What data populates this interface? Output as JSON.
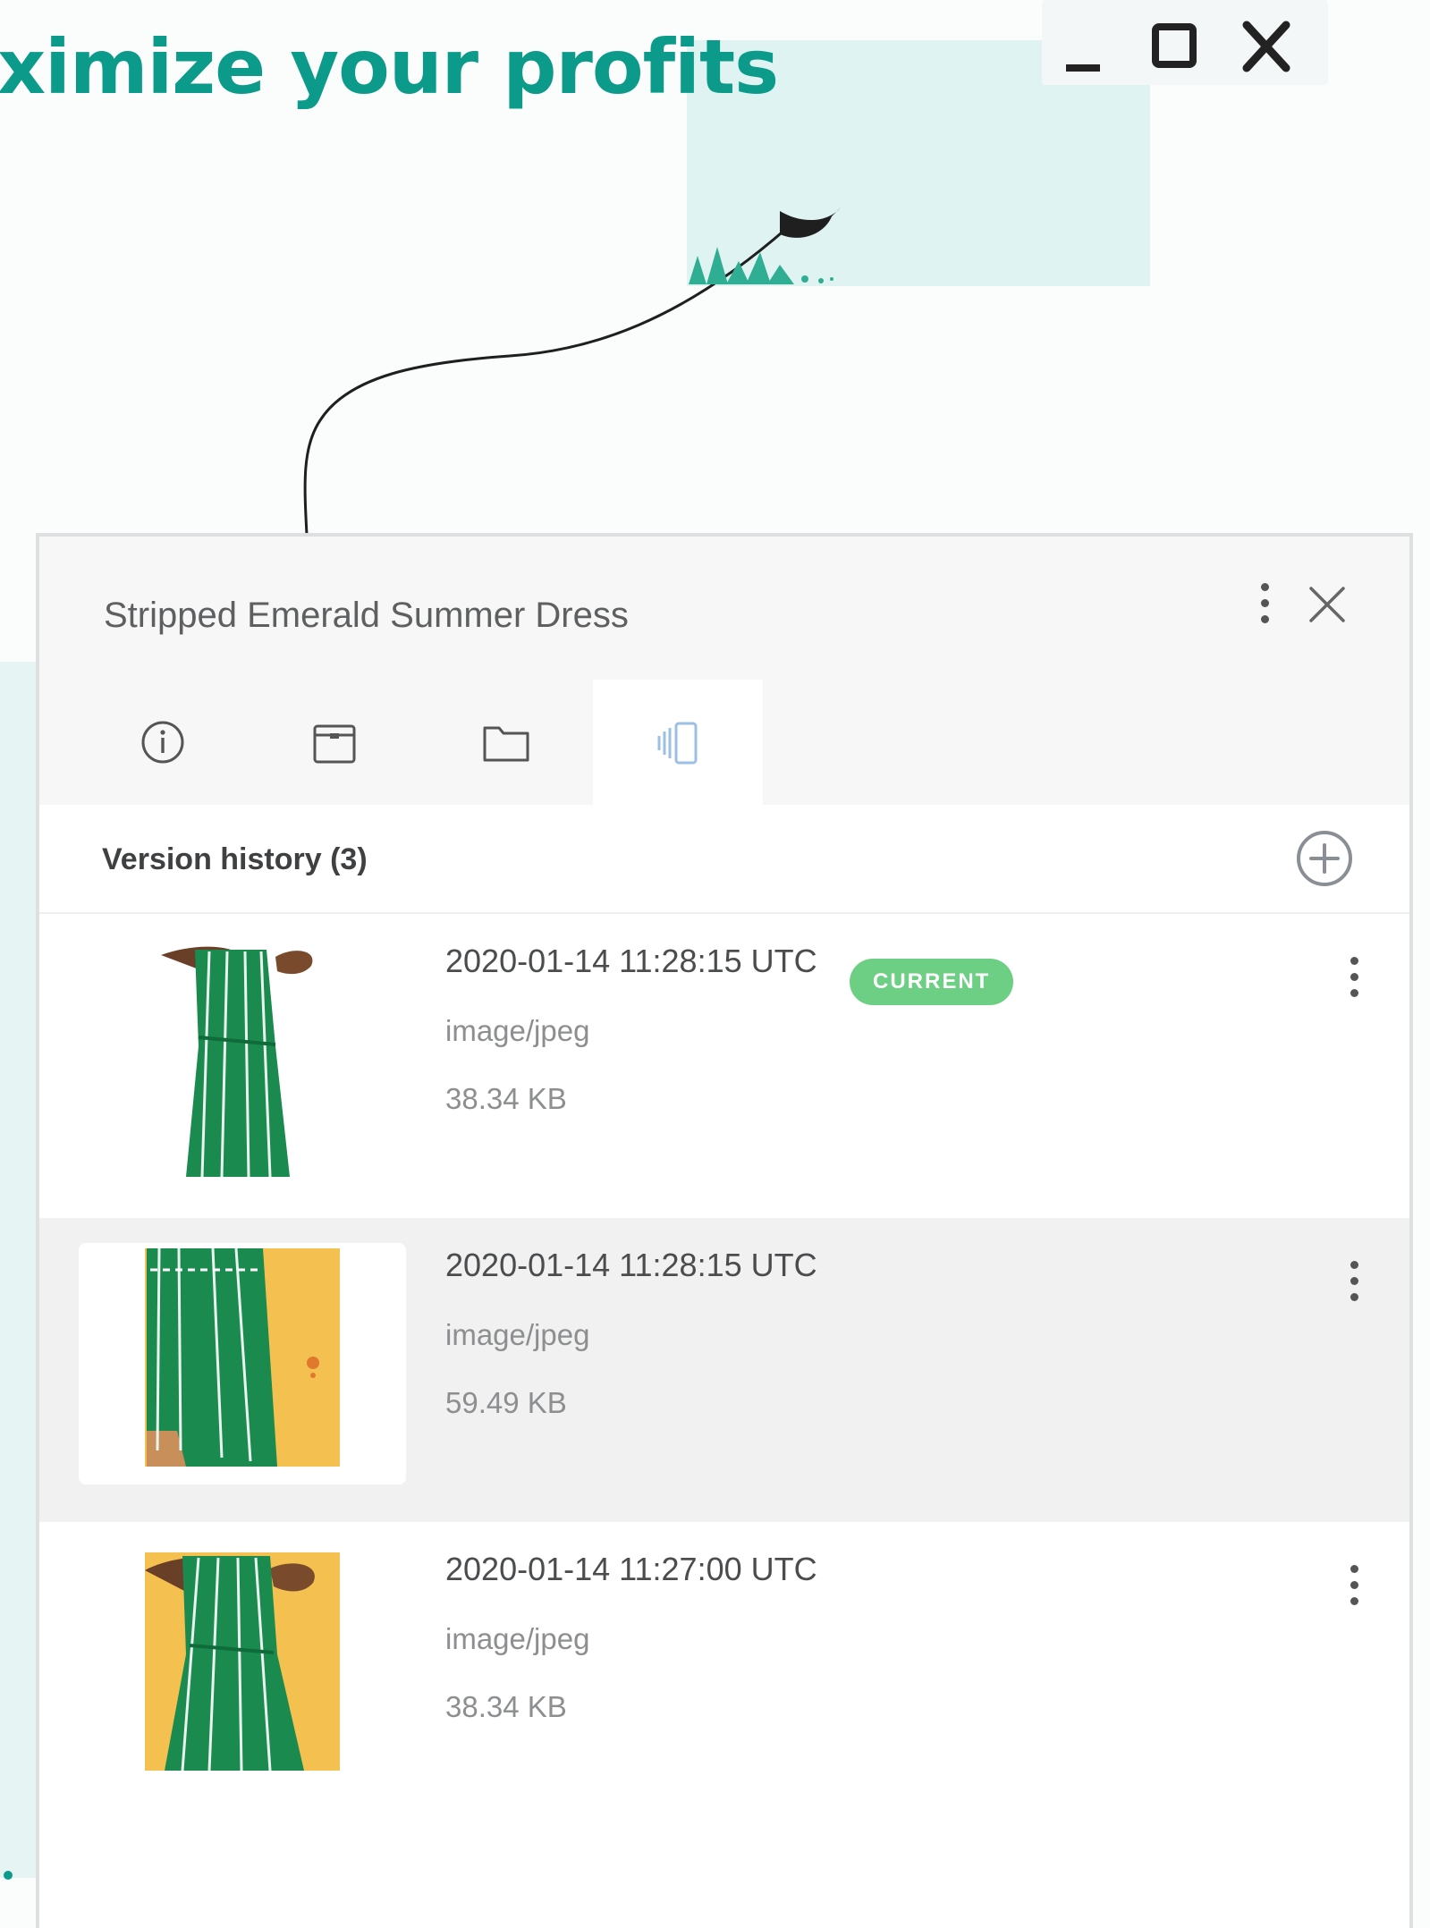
{
  "headline": "ximize your profits",
  "window_controls": {
    "minimize_icon": "minimize-icon",
    "maximize_icon": "maximize-icon",
    "close_icon": "close-icon"
  },
  "panel": {
    "title": "Stripped Emerald Summer Dress",
    "tabs": [
      {
        "icon": "info-icon",
        "active": false
      },
      {
        "icon": "package-icon",
        "active": false
      },
      {
        "icon": "folder-icon",
        "active": false
      },
      {
        "icon": "versions-icon",
        "active": true
      }
    ],
    "section_title": "Version history (3)",
    "versions": [
      {
        "date": "2020-01-14 11:28:15 UTC",
        "type": "image/jpeg",
        "size": "38.34 KB",
        "badge": "CURRENT"
      },
      {
        "date": "2020-01-14 11:28:15 UTC",
        "type": "image/jpeg",
        "size": "59.49 KB"
      },
      {
        "date": "2020-01-14 11:27:00 UTC",
        "type": "image/jpeg",
        "size": "38.34 KB"
      }
    ]
  },
  "colors": {
    "brand_teal": "#0c9a8a",
    "badge_green": "#6dcf83",
    "dress_green": "#1b8a4f",
    "thumb_yellow": "#f4c050"
  }
}
